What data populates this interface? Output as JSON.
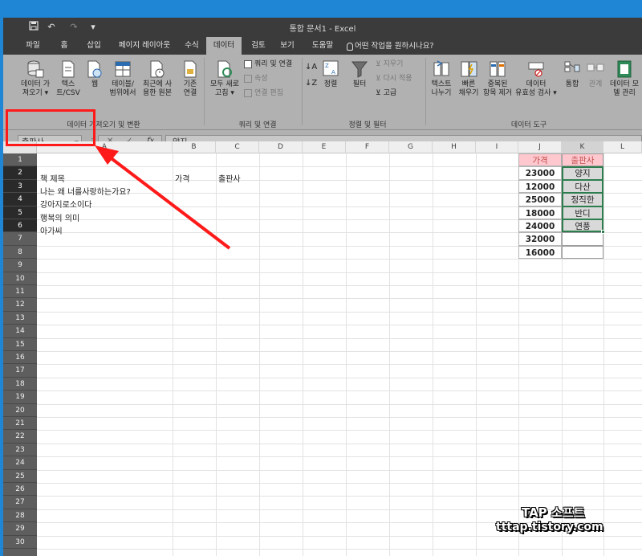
{
  "window": {
    "title": "통합 문서1 - Excel"
  },
  "qat": {
    "save_icon": "save-icon",
    "undo": "↶",
    "redo": "↷",
    "more": "▾"
  },
  "tabs": [
    "파일",
    "홈",
    "삽입",
    "페이지 레이아웃",
    "수식",
    "데이터",
    "검토",
    "보기",
    "도움말"
  ],
  "active_tab": "데이터",
  "tell_me": "어떤 작업을 원하시나요?",
  "ribbon": {
    "get_data": {
      "line1": "데이터 가",
      "line2": "져오기 ▾"
    },
    "text_csv": {
      "line1": "텍스",
      "line2": "트/CSV"
    },
    "web": {
      "line1": "웹",
      "line2": ""
    },
    "from_table": {
      "line1": "테이블/",
      "line2": "범위에서"
    },
    "recent_sources": {
      "line1": "최근에 사",
      "line2": "용한 원본"
    },
    "existing_conn": {
      "line1": "기존",
      "line2": "연결"
    },
    "group_get": "데이터 가져오기 및 변환",
    "refresh_all": {
      "line1": "모두 새로",
      "line2": "고침 ▾"
    },
    "queries_conn": "쿼리 및 연결",
    "properties": "속성",
    "edit_links": "연결 편집",
    "group_queries": "쿼리 및 연결",
    "sort": "정렬",
    "filter": "필터",
    "clear": "지우기",
    "reapply": "다시 적용",
    "advanced": "고급",
    "group_sort": "정렬 및 필터",
    "text_to_columns": {
      "line1": "텍스트",
      "line2": "나누기"
    },
    "flash_fill": {
      "line1": "빠른",
      "line2": "채우기"
    },
    "remove_dup": {
      "line1": "중복된",
      "line2": "항목 제거"
    },
    "validation": {
      "line1": "데이터",
      "line2": "유효성 검사 ▾"
    },
    "consolidate": "통합",
    "relationships": "관계",
    "data_model": {
      "line1": "데이터 모",
      "line2": "델 관리"
    },
    "group_tools": "데이터 도구"
  },
  "formula_bar": {
    "name_box": "출판사",
    "cancel": "✕",
    "enter": "✓",
    "fx": "fx",
    "value": "양지"
  },
  "columns": [
    "A",
    "B",
    "C",
    "D",
    "E",
    "F",
    "G",
    "H",
    "I",
    "J",
    "K",
    "L"
  ],
  "rows": [
    "1",
    "2",
    "3",
    "4",
    "5",
    "6",
    "7",
    "8",
    "9",
    "10",
    "11",
    "12",
    "13",
    "14",
    "15",
    "16",
    "17",
    "18",
    "19",
    "20",
    "21",
    "22",
    "23",
    "24",
    "25",
    "26",
    "27",
    "28",
    "29",
    "30"
  ],
  "cells": {
    "A1": "책 제목",
    "B1": "가격",
    "C1": "출판사",
    "A2": "나는 왜 너를사랑하는가요?",
    "A3": "강아지로소이다",
    "A4": "행복의 의미",
    "A5": "아가씨"
  },
  "table_j": [
    "가격",
    "23000",
    "12000",
    "25000",
    "18000",
    "24000",
    "32000",
    "16000"
  ],
  "table_k": [
    "출판사",
    "양지",
    "다산",
    "정직한",
    "반디",
    "연풍",
    "",
    ""
  ],
  "watermark": {
    "line1": "TAP 소프트",
    "line2": "tttap.tistory.com"
  },
  "colors": {
    "accent_red": "#ff1a1a",
    "header_pink": "#ffc7ce",
    "ribbon_gray": "#b1b1b1",
    "title_dark": "#3b3b3b"
  }
}
